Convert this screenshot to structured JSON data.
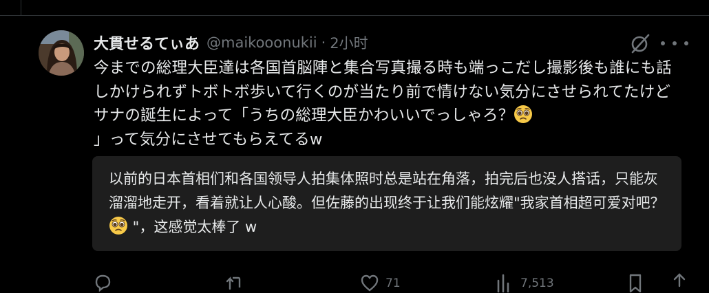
{
  "tweet": {
    "display_name": "大貫せるてぃあ",
    "handle": "@maikooonukii",
    "separator": "·",
    "time": "2小时",
    "text_segments": [
      "今までの総理大臣達は各国首脳陣と集合写真撮る時も端っこだし撮影後も誰にも話しかけられずトボトボ歩いて行くのが当たり前で情けない気分にさせられてたけどサナの誕生によって「うちの総理大臣かわいいでっしゃろ？",
      "」って気分にさせてもらえてるw"
    ],
    "emoji_name": "pleading-face"
  },
  "translation": {
    "segments": [
      "以前的日本首相们和各国领导人拍集体照时总是站在角落，拍完后也没人搭话，只能灰溜溜地走开，看着就让人心酸。但佐藤的出现终于让我们能炫耀\"我家首相超可爱对吧？ ",
      " \"，这感觉太棒了 w"
    ]
  },
  "actions": {
    "reply_icon": "reply-icon",
    "retweet_icon": "retweet-icon",
    "like_icon": "heart-icon",
    "like_count": "71",
    "views_icon": "bar-chart-icon",
    "views_count": "7,513",
    "bookmark_icon": "bookmark-icon",
    "share_icon": "share-icon"
  },
  "colors": {
    "background": "#000000",
    "text": "#e7e9ea",
    "secondary": "#71767b",
    "translation_bg": "#1e1e1e",
    "divider": "#2f3336"
  }
}
